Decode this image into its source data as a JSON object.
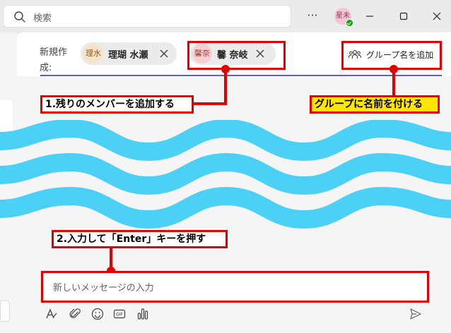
{
  "search": {
    "placeholder": "検索"
  },
  "titlebar": {
    "more_icon": "more-horizontal-icon",
    "user_avatar_initials": "星未",
    "status_color": "#13a10e",
    "window_buttons": [
      "minimize-icon",
      "maximize-icon",
      "close-icon"
    ]
  },
  "new_chat": {
    "label": "新規作成:",
    "recipients": [
      {
        "initials": "理水",
        "name": "理瑚 水瀬",
        "avatar_bg": "#f7e4c8",
        "avatar_fg": "#8a5a1a"
      },
      {
        "initials": "馨奈",
        "name": "馨 奈岐",
        "avatar_bg": "#f6d0d0",
        "avatar_fg": "#9a3a3a"
      }
    ],
    "add_group_name_label": "グループ名を追加"
  },
  "annotations": {
    "add_members": "1.残りのメンバーを追加する",
    "group_name": "グループに名前を付ける",
    "press_enter": "2.入力して「Enter」キーを押す"
  },
  "compose": {
    "placeholder": "新しいメッセージの入力",
    "tools": [
      "format-icon",
      "attach-icon",
      "emoji-icon",
      "gif-icon",
      "poll-icon"
    ],
    "send_icon": "send-icon"
  },
  "colors": {
    "accent": "#5b5fc7",
    "annotation_red": "#e00000",
    "wave": "#4dd0f5",
    "highlight_yellow": "#ffe600"
  }
}
